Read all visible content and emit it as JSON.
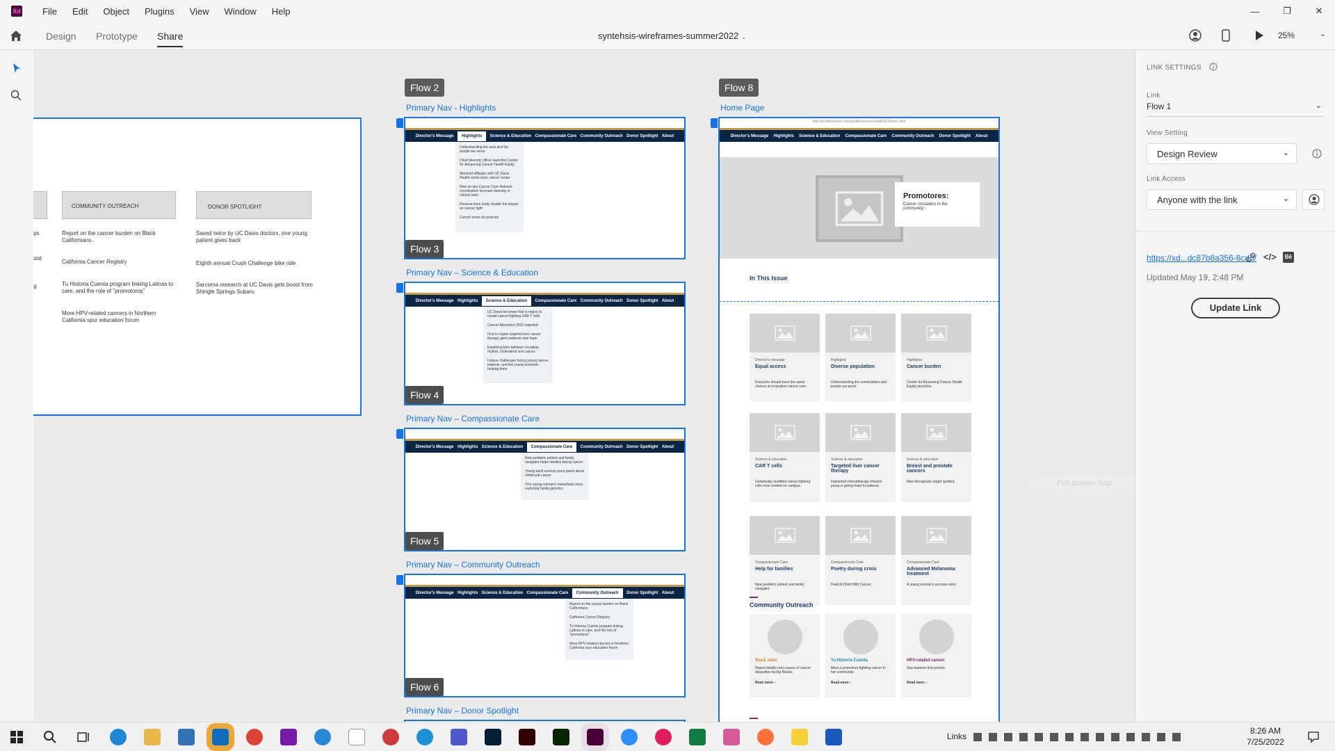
{
  "app": {
    "logo": "Xd",
    "menu": [
      "File",
      "Edit",
      "Object",
      "Plugins",
      "View",
      "Window",
      "Help"
    ],
    "window_controls": [
      "—",
      "❐",
      "✕"
    ]
  },
  "toolbar": {
    "tabs": [
      "Design",
      "Prototype",
      "Share"
    ],
    "active_tab": "Share",
    "doc_title": "syntehsis-wireframes-summer2022",
    "zoom": "25%"
  },
  "left_artboard": {
    "headers": [
      "COMMUNITY OUTREACH",
      "DONOR SPOTLIGHT"
    ],
    "edge_fragments": [
      "elps",
      "hood",
      "ing"
    ],
    "col1": [
      "Report on the cancer burden on Black Californians.",
      "California Cancer Registry",
      "Tu Historia Cuenta program linking Latinas to care, and the role of \"promotoros\"",
      "More HPV-related cancers in Northern California spur education forum"
    ],
    "col2": [
      "Saved twice by UC Davis doctors, one young patient gives back",
      "Eighth annual Crush Challenge bike ride",
      "Sarcoma research at UC Davis gets boost from Shingle Springs Subaru"
    ]
  },
  "nav_items": [
    "Director's Message",
    "Highlights",
    "Science & Education",
    "Compassionate Care",
    "Community Outreach",
    "Donor Spotlight",
    "About"
  ],
  "flows": {
    "flow2": "Flow 2",
    "flow3": "Flow 3",
    "flow4": "Flow 4",
    "flow5": "Flow 5",
    "flow6": "Flow 6",
    "flow8": "Flow 8"
  },
  "artboards": [
    {
      "label": "Primary Nav - Highlights",
      "active": "Highlights",
      "items": [
        "Understanding the area and the people we serve",
        "Chief diversity officer launches Center for Advancing Cancer Health Equity",
        "Marshall affiliates with UC Davis Health world-class cancer center",
        "New on-site Cancer Care Network coordination increase diversity in clinical trials",
        "Reverse lines study double the impact on cancer fight",
        "Cancer news via podcast"
      ]
    },
    {
      "label": "Primary Nav – Science & Education",
      "active": "Science & Education",
      "items": [
        "UC Davis becomes first in region to create cancer-fighting CAR T cells",
        "Cancer Moonshot 2022 reignited",
        "First in region targeted liver cancer therapy gives patients new hope",
        "Exploring links between circadian rhythm, cholesterol and cancer",
        "Unique challenges facing young cancer patients, and the young scientists helping them"
      ]
    },
    {
      "label": "Primary Nav – Compassionate Care",
      "active": "Compassionate Care",
      "items": [
        "New pediatric patient and family navigator helps families facing cancer",
        "Young adult survivor pens poem about childhood cancer",
        "One young woman's metastasis story, exploring family genetics"
      ]
    },
    {
      "label": "Primary Nav – Community Outreach",
      "active": "Community Outreach",
      "items": [
        "Report on the cancer burden on Black Californians",
        "California Cancer Registry",
        "Tu Historia Cuenta program linking Latinas to care, and the role of \"promotoros\"",
        "More HPV-related cancers in Northern California spur education forum"
      ]
    }
  ],
  "next_label": "Primary Nav – Donor Spotlight",
  "home": {
    "label": "Home Page",
    "url": "http://healthucdavis.edu/synthesis/issues/fall2022/index.html",
    "promo_title": "Promotores:",
    "promo_text": "Cancer crusaders in the community ›",
    "in_this_issue": "In This Issue",
    "cards": [
      {
        "cat": "Director's message",
        "title": "Equal access",
        "desc": "Everyone should have the same chance at innovative cancer care."
      },
      {
        "cat": "Highlights",
        "title": "Diverse population",
        "desc": "Understanding the communities and people we serve."
      },
      {
        "cat": "Highlights",
        "title": "Cancer burden",
        "desc": "Center for Advancing Cancer Health Equity launches."
      },
      {
        "cat": "Science & education",
        "title": "CAR T cells",
        "desc": "Genetically modified cancer-fighting cells now created on campus."
      },
      {
        "cat": "Science & education",
        "title": "Targeted liver cancer therapy",
        "desc": "Implanted chemotherapy infusion pump is giving hope to patients."
      },
      {
        "cat": "Science & education",
        "title": "Breast and prostate cancers",
        "desc": "New therapeutic target spotted."
      },
      {
        "cat": "Compassionate Care",
        "title": "Help for families",
        "desc": "New pediatric patient and family navigator."
      },
      {
        "cat": "Compassionate Care",
        "title": "Poetry during crisis",
        "desc": "Dead A Child With Cancer."
      },
      {
        "cat": "Compassionate Care",
        "title": "Advanced Melanoma treatment",
        "desc": "A young woman's success story."
      }
    ],
    "community_outreach": "Community Outreach",
    "outreach": [
      {
        "title": "Black stats",
        "desc": "Report details root causes of cancer disparities facing Blacks.",
        "read": "Read more ›"
      },
      {
        "title": "Tu Historia Cuenta",
        "desc": "Meet a promotora fighting cancer in her community.",
        "read": "Read more ›"
      },
      {
        "title": "HPV-related cancer",
        "desc": "Vaccinations that protect.",
        "read": "Read more ›"
      }
    ]
  },
  "right_panel": {
    "heading": "LINK SETTINGS",
    "link_label": "Link",
    "link_value": "Flow 1",
    "view_label": "View Setting",
    "view_value": "Design Review",
    "access_label": "Link Access",
    "access_value": "Anyone with the link",
    "url": "https://xd...dc87b8a356-8cd3/",
    "updated": "Updated May 19, 2:48 PM",
    "update_button": "Update Link",
    "ghost": "Full-screen Snip"
  },
  "taskbar": {
    "links": "Links",
    "time": "8:26 AM",
    "date": "7/25/2022"
  },
  "colors": {
    "accent": "#1473e6",
    "navy": "#0b2544",
    "gold": "#c39b4a"
  }
}
